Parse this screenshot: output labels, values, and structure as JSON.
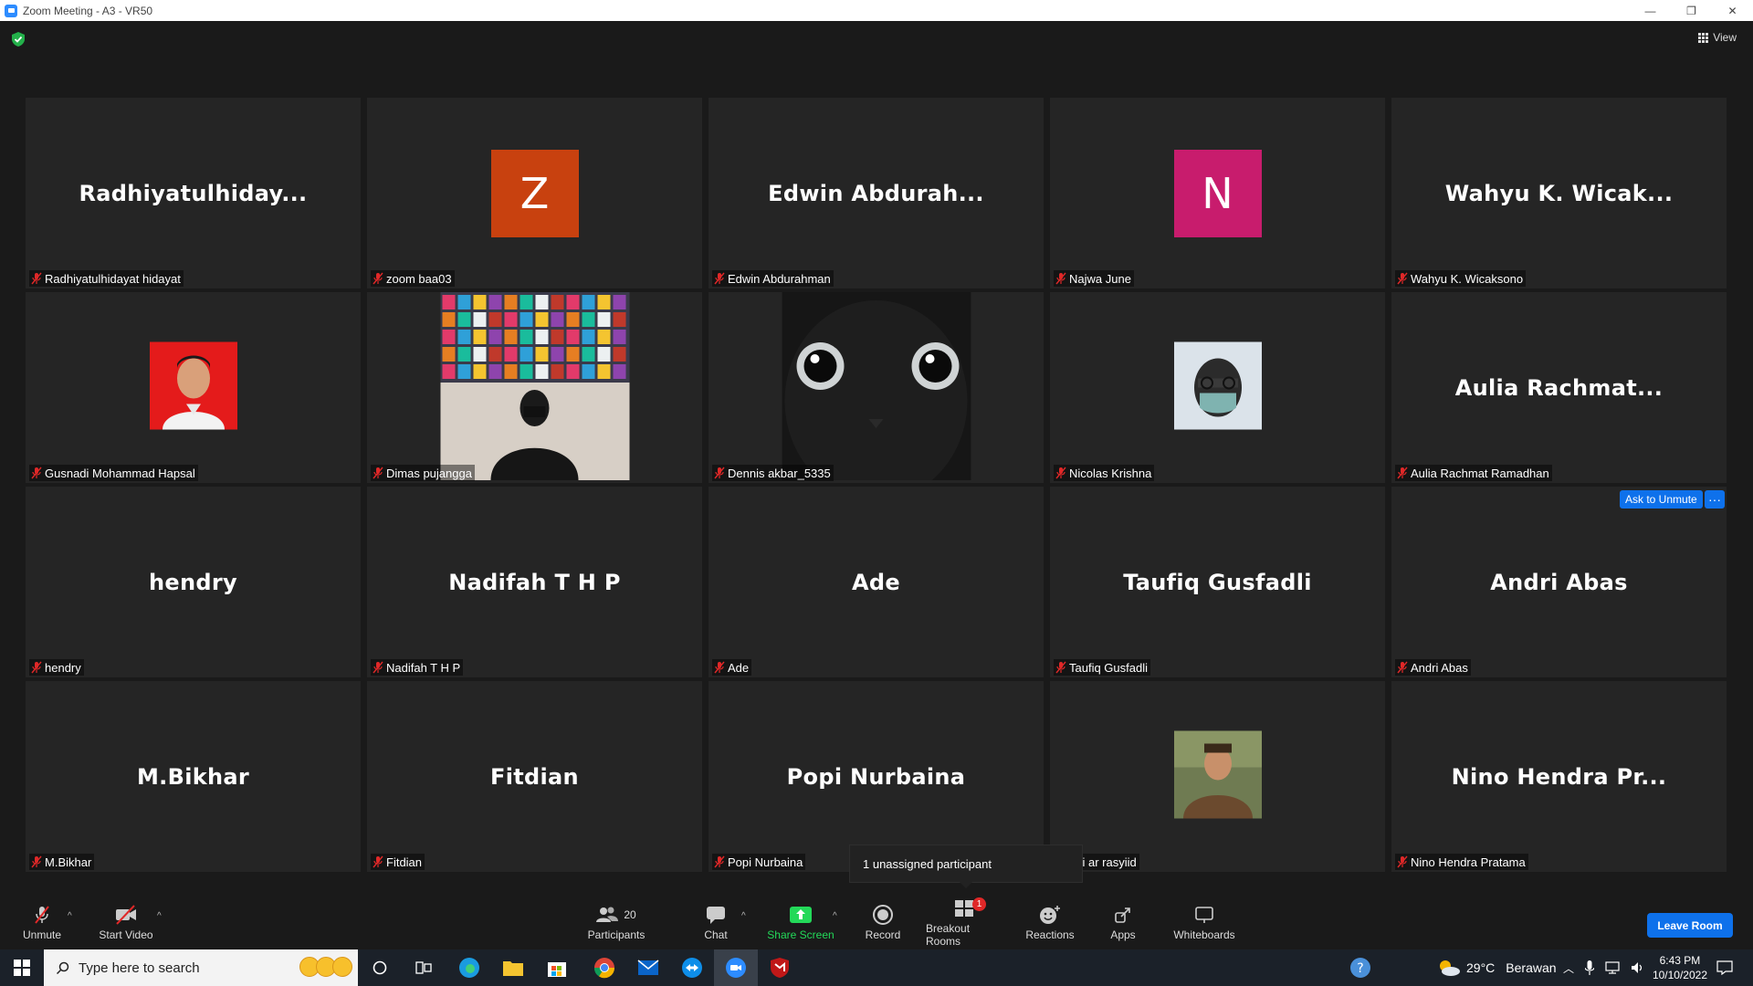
{
  "window": {
    "title": "Zoom Meeting - A3 - VR50",
    "minimize": "—",
    "restore": "❐",
    "close": "✕"
  },
  "header": {
    "view_label": "View"
  },
  "tiles": [
    {
      "big": "Radhiyatulhiday...",
      "name": "Radhiyatulhidayat hidayat",
      "type": "text"
    },
    {
      "big": "Z",
      "name": "zoom baa03",
      "type": "letter",
      "color": "#c8410f"
    },
    {
      "big": "Edwin Abdurah...",
      "name": "Edwin Abdurahman",
      "type": "text"
    },
    {
      "big": "N",
      "name": "Najwa June",
      "type": "letter",
      "color": "#c81c6d"
    },
    {
      "big": "Wahyu K. Wicak...",
      "name": "Wahyu K. Wicaksono",
      "type": "text"
    },
    {
      "big": "",
      "name": "Gusnadi Mohammad Hapsal",
      "type": "photo"
    },
    {
      "big": "",
      "name": "Dimas pujangga",
      "type": "photo"
    },
    {
      "big": "",
      "name": "Dennis akbar_5335",
      "type": "photo"
    },
    {
      "big": "",
      "name": "Nicolas Krishna",
      "type": "photo"
    },
    {
      "big": "Aulia Rachmat...",
      "name": "Aulia Rachmat Ramadhan",
      "type": "text"
    },
    {
      "big": "hendry",
      "name": "hendry",
      "type": "text"
    },
    {
      "big": "Nadifah T H P",
      "name": "Nadifah T H P",
      "type": "text"
    },
    {
      "big": "Ade",
      "name": "Ade",
      "type": "text"
    },
    {
      "big": "Taufiq Gusfadli",
      "name": "Taufiq Gusfadli",
      "type": "text"
    },
    {
      "big": "Andri Abas",
      "name": "Andri Abas",
      "type": "text"
    },
    {
      "big": "M.Bikhar",
      "name": "M.Bikhar",
      "type": "text"
    },
    {
      "big": "Fitdian",
      "name": "Fitdian",
      "type": "text"
    },
    {
      "big": "Popi Nurbaina",
      "name": "Popi Nurbaina",
      "type": "text"
    },
    {
      "big": "",
      "name": "nni ar rasyiid",
      "type": "photo"
    },
    {
      "big": "Nino Hendra Pr...",
      "name": "Nino Hendra Pratama",
      "type": "text"
    }
  ],
  "hover": {
    "ask_unmute": "Ask to Unmute",
    "more": "···"
  },
  "tooltip": {
    "text": "1 unassigned participant"
  },
  "toolbar": {
    "unmute": "Unmute",
    "start_video": "Start Video",
    "participants": "Participants",
    "participants_count": "20",
    "chat": "Chat",
    "share_screen": "Share Screen",
    "record": "Record",
    "breakout_rooms": "Breakout Rooms",
    "breakout_badge": "1",
    "reactions": "Reactions",
    "apps": "Apps",
    "whiteboards": "Whiteboards",
    "leave": "Leave Room"
  },
  "taskbar": {
    "search_placeholder": "Type here to search",
    "weather_temp": "29°C",
    "weather_text": "Berawan",
    "time": "6:43 PM",
    "date": "10/10/2022"
  },
  "colors": {
    "accent": "#0e71eb",
    "share_green": "#23d959",
    "mute_red": "#e02828",
    "tile_bg": "#252525"
  }
}
